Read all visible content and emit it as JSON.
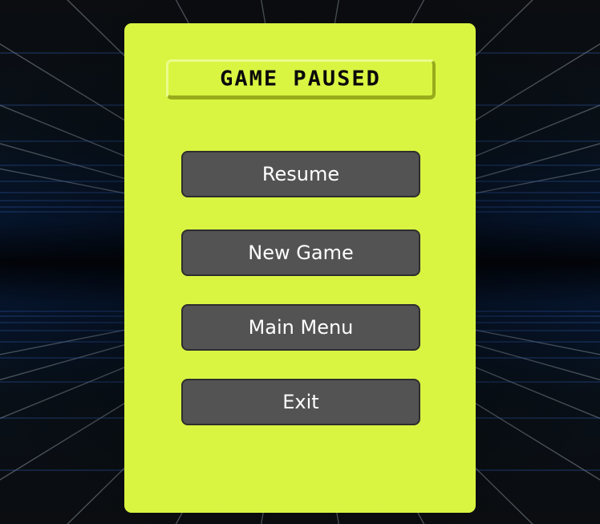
{
  "pause_menu": {
    "title": "GAME PAUSED",
    "buttons": {
      "resume": "Resume",
      "new_game": "New Game",
      "main_menu": "Main Menu",
      "exit": "Exit"
    }
  },
  "colors": {
    "panel": "#d9f542",
    "button": "#535353",
    "button_text": "#ffffff",
    "grid_lines": "#c9d6e0",
    "horizon_glow": "#1e3f9a",
    "background": "#050608"
  },
  "background_scene": "retro-neon-grid"
}
